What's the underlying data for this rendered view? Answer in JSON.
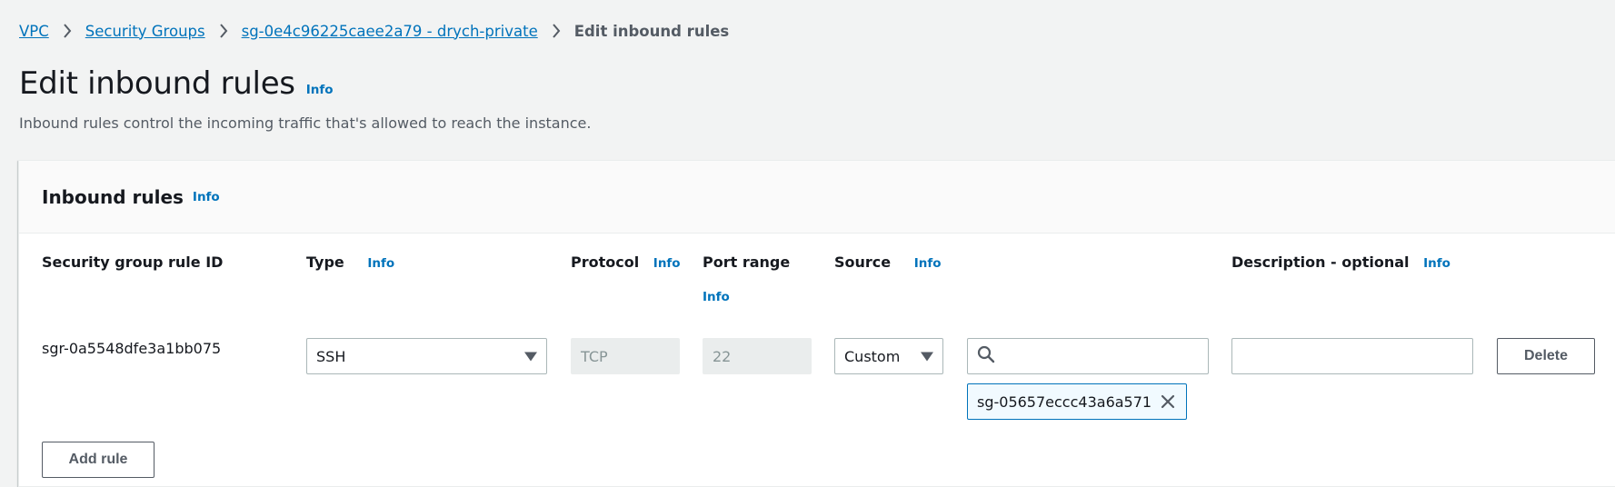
{
  "breadcrumb": {
    "items": [
      "VPC",
      "Security Groups",
      "sg-0e4c96225caee2a79 - drych-private"
    ],
    "current": "Edit inbound rules"
  },
  "page": {
    "title": "Edit inbound rules",
    "info": "Info",
    "description": "Inbound rules control the incoming traffic that's allowed to reach the instance."
  },
  "panel": {
    "title": "Inbound rules",
    "info": "Info",
    "columns": {
      "rule_id": "Security group rule ID",
      "type": "Type",
      "protocol": "Protocol",
      "port_range": "Port range",
      "source": "Source",
      "description": "Description - optional"
    },
    "info_label": "Info",
    "rules": [
      {
        "rule_id": "sgr-0a5548dfe3a1bb075",
        "type": "SSH",
        "protocol": "TCP",
        "port_range": "22",
        "source_type": "Custom",
        "source_search": "",
        "source_token": "sg-05657eccc43a6a571",
        "description": "",
        "delete_label": "Delete"
      }
    ],
    "add_rule_label": "Add rule"
  },
  "icons": {
    "separator": "chevron-right-icon",
    "caret": "caret-down-icon",
    "search": "search-icon",
    "remove": "close-icon"
  },
  "colors": {
    "link": "#0073bb",
    "background": "#f2f3f3",
    "text": "#16191f"
  }
}
